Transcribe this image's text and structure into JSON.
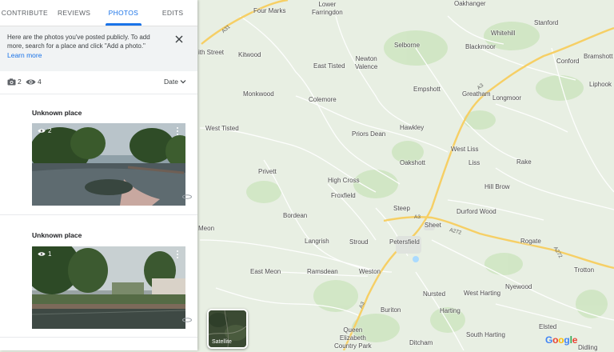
{
  "tabs": [
    {
      "label": "CONTRIBUTE",
      "active": false
    },
    {
      "label": "REVIEWS",
      "active": false
    },
    {
      "label": "PHOTOS",
      "active": true
    },
    {
      "label": "EDITS",
      "active": false
    }
  ],
  "notice": {
    "text": "Here are the photos you've posted publicly. To add more, search for a place and click \"Add a photo.\"",
    "link": "Learn more"
  },
  "stats": {
    "photos": "2",
    "views": "4"
  },
  "sort": {
    "label": "Date"
  },
  "photos": [
    {
      "title": "Unknown place",
      "views": "2"
    },
    {
      "title": "Unknown place",
      "views": "1"
    }
  ],
  "map": {
    "places": [
      {
        "name": "Four Marks",
        "icon": null
      },
      {
        "name": "Lower\nFarringdon"
      },
      {
        "name": "Oakhanger"
      },
      {
        "name": "Stanford"
      },
      {
        "name": "Whitehill"
      },
      {
        "name": "Bramshott"
      },
      {
        "name": "Conford"
      },
      {
        "name": "Liphook"
      },
      {
        "name": "Blackmoor"
      },
      {
        "name": "Selborne"
      },
      {
        "name": "Newton\nValence"
      },
      {
        "name": "East Tisted"
      },
      {
        "name": "Kitwood"
      },
      {
        "name": "ith Street"
      },
      {
        "name": "Empshott"
      },
      {
        "name": "Greatham"
      },
      {
        "name": "Longmoor"
      },
      {
        "name": "Monkwood"
      },
      {
        "name": "Colemore"
      },
      {
        "name": "Hawkley"
      },
      {
        "name": "West Tisted"
      },
      {
        "name": "Priors Dean"
      },
      {
        "name": "West Liss"
      },
      {
        "name": "Oakshott"
      },
      {
        "name": "Liss"
      },
      {
        "name": "Rake"
      },
      {
        "name": "Privett"
      },
      {
        "name": "High Cross"
      },
      {
        "name": "Hill Brow"
      },
      {
        "name": "Froxfield"
      },
      {
        "name": "Steep"
      },
      {
        "name": "Durford Wood"
      },
      {
        "name": "Bordean"
      },
      {
        "name": "Sheet"
      },
      {
        "name": "Meon"
      },
      {
        "name": "Langrish"
      },
      {
        "name": "Stroud"
      },
      {
        "name": "Petersfield"
      },
      {
        "name": "Rogate"
      },
      {
        "name": "Trotton"
      },
      {
        "name": "East Meon"
      },
      {
        "name": "Ramsdean"
      },
      {
        "name": "Weston"
      },
      {
        "name": "Nyewood"
      },
      {
        "name": "Nursted"
      },
      {
        "name": "West Harting"
      },
      {
        "name": "Buriton"
      },
      {
        "name": "Harting"
      },
      {
        "name": "Queen\nElizabeth\nCountry Park"
      },
      {
        "name": "Ditcham"
      },
      {
        "name": "South Harting"
      },
      {
        "name": "Elsted"
      },
      {
        "name": "Didling"
      }
    ],
    "road_labels": [
      "A31",
      "A3",
      "A3",
      "A272",
      "A272",
      "A3"
    ],
    "satellite_label": "Satellite",
    "logo": "Google",
    "colors": {
      "land": "#e8efe3",
      "road_major": "#f9d36b",
      "road_minor": "#ffffff",
      "water": "#aadaff",
      "woodland": "#c9e4bc"
    }
  }
}
